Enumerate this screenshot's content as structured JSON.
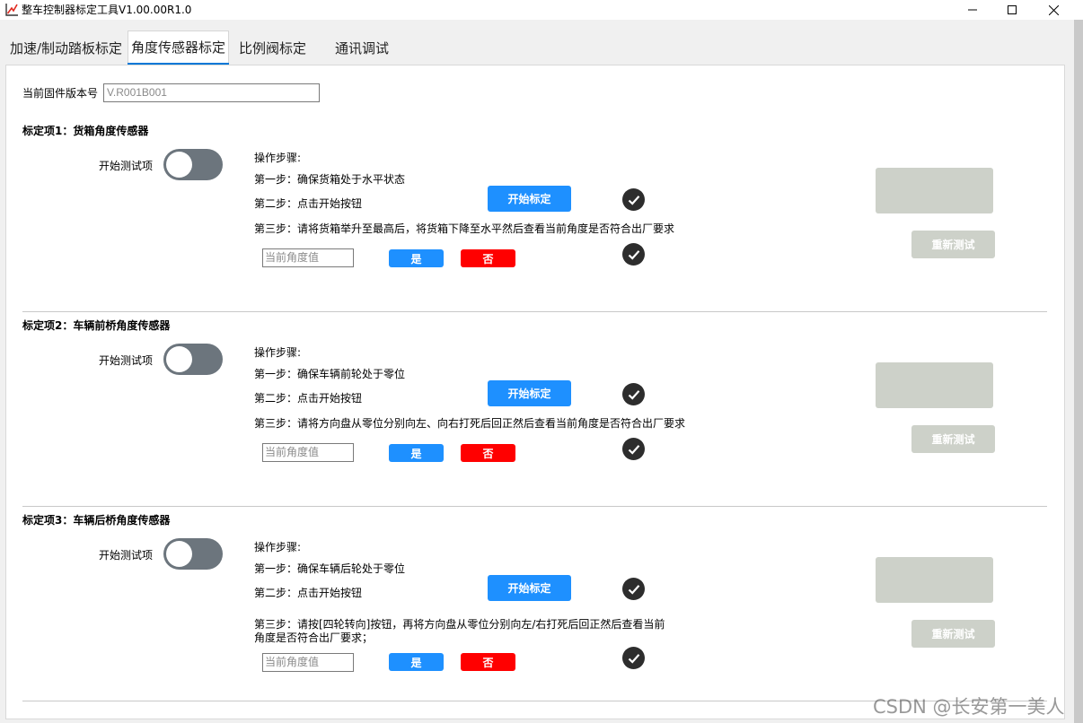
{
  "window": {
    "title": "整车控制器标定工具V1.00.00R1.0",
    "app_icon": "chart-icon"
  },
  "tabs": [
    {
      "label": "加速/制动踏板标定",
      "selected": false
    },
    {
      "label": "角度传感器标定",
      "selected": true
    },
    {
      "label": "比例阀标定",
      "selected": false
    },
    {
      "label": "通讯调试",
      "selected": false
    }
  ],
  "firmware": {
    "label": "当前固件版本号",
    "value": "V.R001B001"
  },
  "sections": [
    {
      "title": "标定项1：货箱角度传感器",
      "start_label": "开始测试项",
      "steps_title": "操作步骤:",
      "step1": "第一步：确保货箱处于水平状态",
      "step2": "第二步：点击开始按钮",
      "step3": "第三步：请将货箱举升至最高后，将货箱下降至水平然后查看当前角度是否符合出厂要求",
      "calibrate_label": "开始标定",
      "angle_placeholder": "当前角度值",
      "yes_label": "是",
      "no_label": "否",
      "retest_label": "重新测试"
    },
    {
      "title": "标定项2：车辆前桥角度传感器",
      "start_label": "开始测试项",
      "steps_title": "操作步骤:",
      "step1": "第一步：确保车辆前轮处于零位",
      "step2": "第二步：点击开始按钮",
      "step3": "第三步：请将方向盘从零位分别向左、向右打死后回正然后查看当前角度是否符合出厂要求",
      "calibrate_label": "开始标定",
      "angle_placeholder": "当前角度值",
      "yes_label": "是",
      "no_label": "否",
      "retest_label": "重新测试"
    },
    {
      "title": "标定项3：车辆后桥角度传感器",
      "start_label": "开始测试项",
      "steps_title": "操作步骤:",
      "step1": "第一步：确保车辆后轮处于零位",
      "step2": "第二步：点击开始按钮",
      "step3": "第三步：请按[四轮转向]按钮，再将方向盘从零位分别向左/右打死后回正然后查看当前角度是否符合出厂要求；",
      "calibrate_label": "开始标定",
      "angle_placeholder": "当前角度值",
      "yes_label": "是",
      "no_label": "否",
      "retest_label": "重新测试"
    }
  ],
  "watermark": "CSDN @长安第一美人",
  "colors": {
    "accent_blue": "#1e90ff",
    "no_red": "#ff0000",
    "toggle_gray": "#6c757d",
    "disabled_gray": "#cdd1c9",
    "check_dark": "#2d2d2d",
    "tab_underline": "#0078d7"
  }
}
